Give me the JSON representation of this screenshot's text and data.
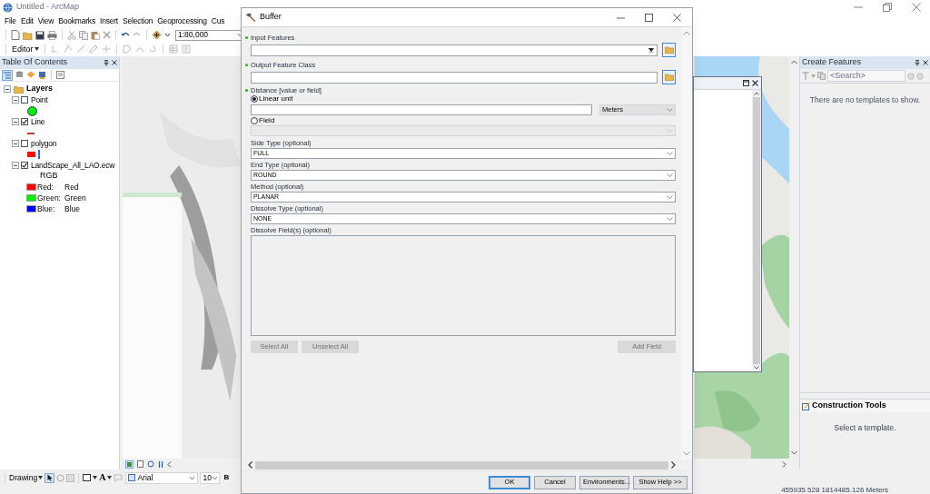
{
  "app_window": {
    "title": "Untitled - ArcMap"
  },
  "menu": [
    "File",
    "Edit",
    "View",
    "Bookmarks",
    "Insert",
    "Selection",
    "Geoprocessing",
    "Cus"
  ],
  "toolbar": {
    "scale": "1:80,000",
    "editor": "Editor"
  },
  "toc": {
    "title": "Table Of Contents",
    "group": {
      "label": "Layers",
      "expanded": true,
      "layers": [
        {
          "name": "Point",
          "checked": false,
          "expanded": true,
          "symbols": [
            {
              "kind": "circle",
              "color": "#00ee00"
            }
          ]
        },
        {
          "name": "Line",
          "checked": true,
          "expanded": true,
          "symbols": [
            {
              "kind": "line",
              "color": "#c0392b"
            }
          ]
        },
        {
          "name": "polygon",
          "checked": false,
          "expanded": true,
          "symbols": [
            {
              "kind": "fill",
              "color": "#ee1111"
            },
            {
              "kind": "bar",
              "color": "#1f6fe0"
            }
          ]
        },
        {
          "name": "LandScape_All_LAO.ecw",
          "checked": true,
          "expanded": true,
          "renderer": "RGB",
          "bands": [
            {
              "label": "Red:",
              "value": "Red",
              "color": "#ff0000"
            },
            {
              "label": "Green:",
              "value": "Green",
              "color": "#00ee00"
            },
            {
              "label": "Blue:",
              "value": "Blue",
              "color": "#0000ee"
            }
          ]
        }
      ]
    }
  },
  "create_features": {
    "title": "Create Features",
    "search_placeholder": "<Search>",
    "message": "There are no templates to show."
  },
  "construction_tools": {
    "title": "Construction Tools",
    "message": "Select a template."
  },
  "drawing_toolbar": {
    "label": "Drawing",
    "text_tool": "A",
    "font": "Arial",
    "size": "10",
    "bold": "B"
  },
  "status_bar": "455935.528  1814485.126 Meters",
  "dialog": {
    "title": "Buffer",
    "params": [
      {
        "kind": "combo",
        "label": "Input Features",
        "required": true
      },
      {
        "kind": "text",
        "label": "Output Feature Class",
        "required": true
      },
      {
        "kind": "distance",
        "label": "Distance [value or field]",
        "required": true,
        "options": [
          {
            "label": "Linear unit",
            "selected": true
          },
          {
            "label": "Field",
            "selected": false
          }
        ],
        "unit": "Meters"
      },
      {
        "kind": "select",
        "label": "Side Type (optional)",
        "required": false,
        "value": "FULL"
      },
      {
        "kind": "select",
        "label": "End Type (optional)",
        "required": false,
        "value": "ROUND"
      },
      {
        "kind": "select",
        "label": "Method (optional)",
        "required": false,
        "value": "PLANAR"
      },
      {
        "kind": "select",
        "label": "Dissolve Type (optional)",
        "required": false,
        "value": "NONE"
      },
      {
        "kind": "list",
        "label": "Dissolve Field(s) (optional)",
        "required": false,
        "buttons": [
          {
            "label": "Select All",
            "disabled": true
          },
          {
            "label": "Unselect All",
            "disabled": true
          },
          {
            "label": "Add Field",
            "disabled": true
          }
        ]
      }
    ],
    "buttons": [
      {
        "label": "OK",
        "focused": true
      },
      {
        "label": "Cancel",
        "focused": false
      },
      {
        "label": "Environments...",
        "focused": false
      },
      {
        "label": "Show Help >>",
        "focused": false
      }
    ]
  }
}
